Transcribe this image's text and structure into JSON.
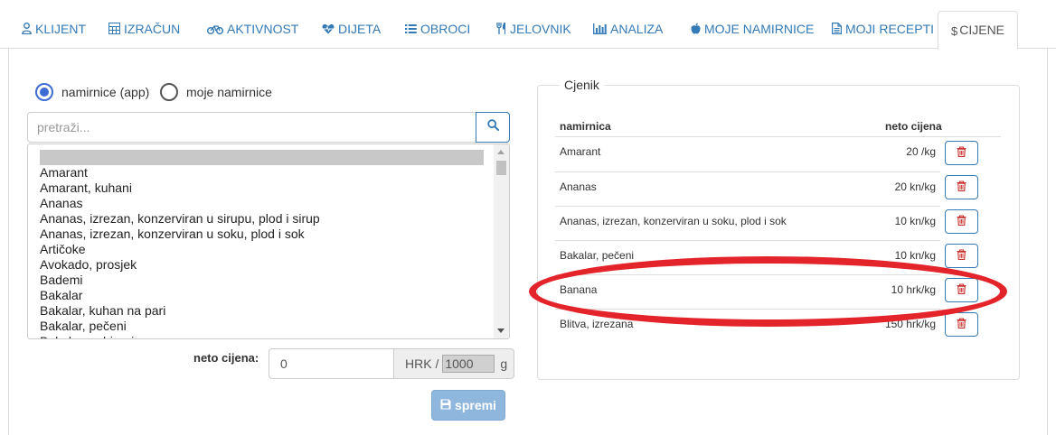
{
  "tabs": [
    {
      "label": "KLIJENT",
      "icon": "user-icon"
    },
    {
      "label": "IZRAČUN",
      "icon": "calculator-icon"
    },
    {
      "label": "AKTIVNOST",
      "icon": "bicycle-icon"
    },
    {
      "label": "DIJETA",
      "icon": "heartbeat-icon"
    },
    {
      "label": "OBROCI",
      "icon": "list-icon"
    },
    {
      "label": "JELOVNIK",
      "icon": "cutlery-icon"
    },
    {
      "label": "ANALIZA",
      "icon": "bar-chart-icon"
    },
    {
      "label": "MOJE NAMIRNICE",
      "icon": "apple-icon"
    },
    {
      "label": "MOJI RECEPTI",
      "icon": "document-icon"
    },
    {
      "label": "CIJENE",
      "icon": "dollar-icon",
      "active": true
    }
  ],
  "source": {
    "option_app": "namirnice (app)",
    "option_mine": "moje namirnice",
    "selected": "app"
  },
  "search": {
    "placeholder": "pretraži...",
    "value": ""
  },
  "food_list": {
    "selected_index": 0,
    "items": [
      "",
      "Amarant",
      "Amarant, kuhani",
      "Ananas",
      "Ananas, izrezan, konzerviran u sirupu, plod i sirup",
      "Ananas, izrezan, konzerviran u soku, plod i sok",
      "Artičoke",
      "Avokado, prosjek",
      "Bademi",
      "Bakalar",
      "Bakalar, kuhan na pari",
      "Bakalar, pečeni",
      "Bakalar, pohirani"
    ]
  },
  "price_form": {
    "label": "neto cijena:",
    "value": "0",
    "currency": "HRK /",
    "quantity": "1000",
    "unit": "g",
    "save_label": "spremi"
  },
  "price_list": {
    "legend": "Cjenik",
    "col_name": "namirnica",
    "col_price": "neto cijena",
    "rows": [
      {
        "name": "Amarant",
        "price": "20 /kg"
      },
      {
        "name": "Ananas",
        "price": "20 kn/kg"
      },
      {
        "name": "Ananas, izrezan, konzerviran u soku, plod i sok",
        "price": "10 kn/kg"
      },
      {
        "name": "Bakalar, pečeni",
        "price": "10 kn/kg"
      },
      {
        "name": "Banana",
        "price": "10 hrk/kg"
      },
      {
        "name": "Blitva, izrezana",
        "price": "150 hrk/kg"
      }
    ]
  },
  "colors": {
    "link": "#337ab7",
    "delete": "#c9302c",
    "highlight_ellipse": "#e3242b",
    "radio": "#3c6cd4"
  }
}
